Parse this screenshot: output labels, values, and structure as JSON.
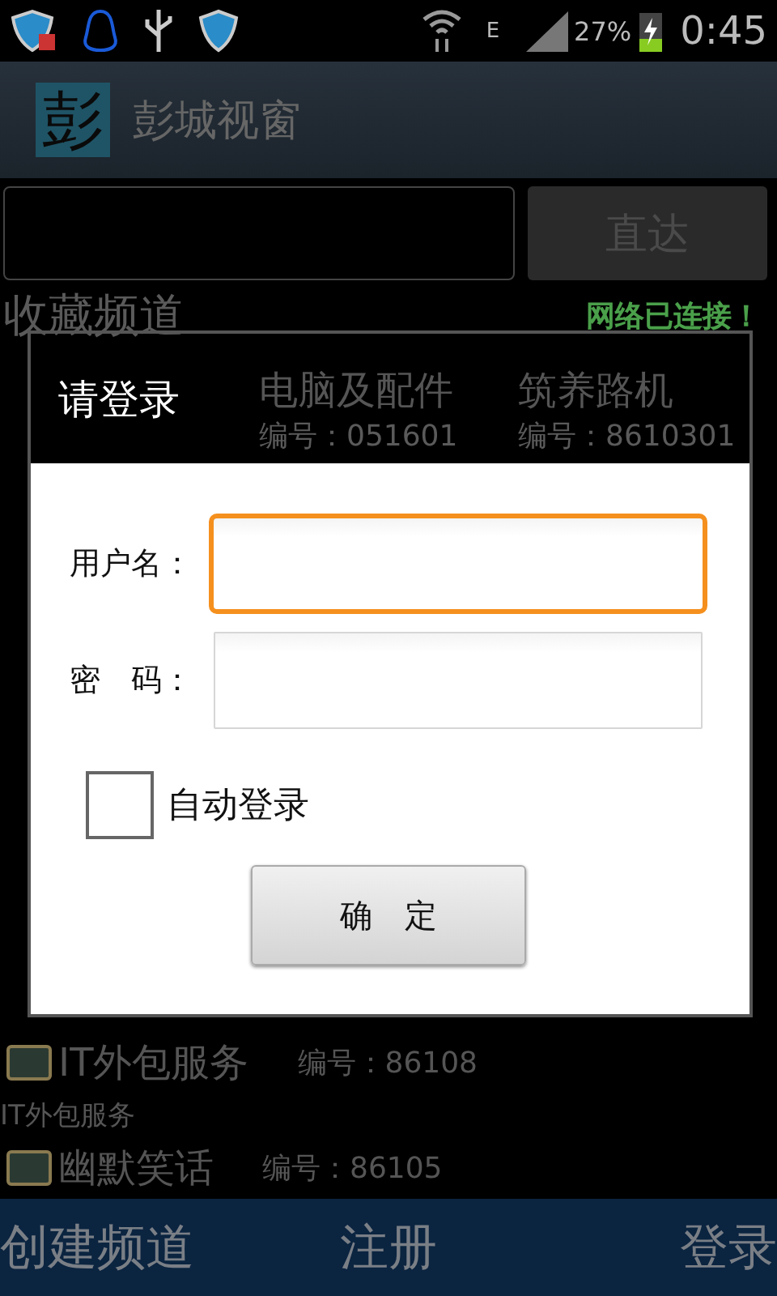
{
  "status_bar": {
    "network": "E",
    "battery": "27%",
    "time": "0:45"
  },
  "app_bar": {
    "logo": "彭",
    "title": "彭城视窗"
  },
  "search": {
    "button": "直达"
  },
  "favorites": {
    "title": "收藏频道",
    "network_status": "网络已连接！",
    "channels": [
      {
        "name": "电脑及配件",
        "id": "编号：051601"
      },
      {
        "name": "筑养路机",
        "id": "编号：8610301"
      }
    ]
  },
  "hot_list": {
    "items": [
      {
        "kind": "channel",
        "name": "IT外包服务",
        "id": "编号：86108"
      },
      {
        "kind": "desc",
        "text": "IT外包服务"
      },
      {
        "kind": "channel",
        "name": "幽默笑话",
        "id": "编号：86105"
      }
    ]
  },
  "bottom_bar": [
    "创建频道",
    "注册",
    "登录"
  ],
  "dialog": {
    "title": "请登录",
    "fields": [
      {
        "label": "用户名：",
        "focused": true
      },
      {
        "label": "密　码：",
        "focused": false
      }
    ],
    "auto_login": {
      "label": "自动登录",
      "checked": false
    },
    "button": "确　定"
  }
}
